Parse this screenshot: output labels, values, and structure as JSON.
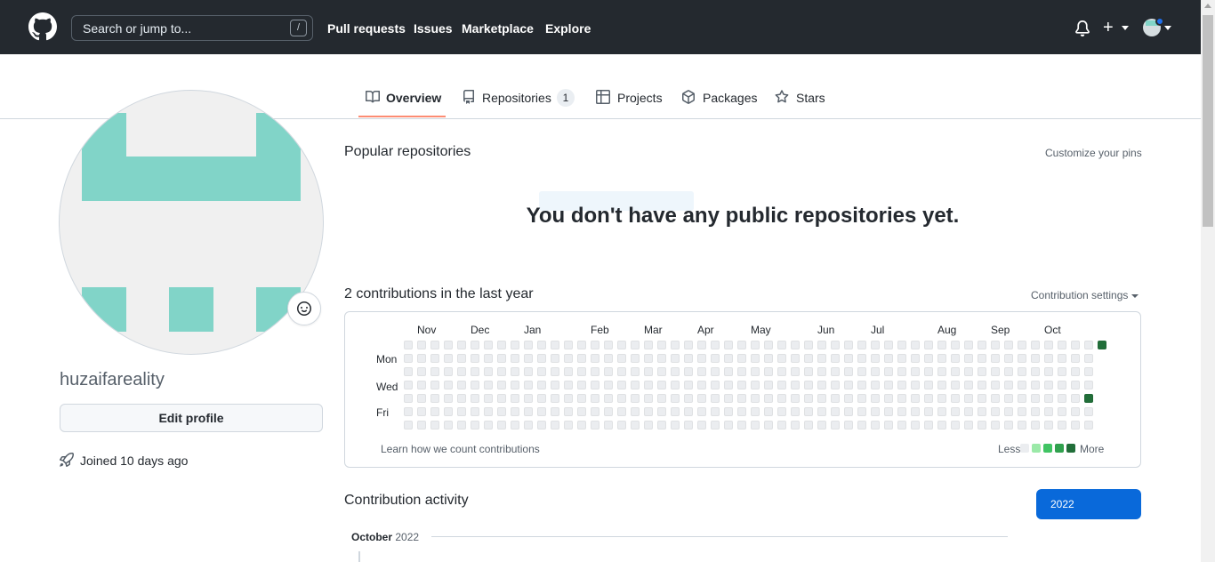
{
  "header": {
    "search_placeholder": "Search or jump to...",
    "search_shortcut": "/",
    "nav": [
      "Pull requests",
      "Issues",
      "Marketplace",
      "Explore"
    ]
  },
  "tabs": {
    "overview": "Overview",
    "repositories": "Repositories",
    "repositories_count": "1",
    "projects": "Projects",
    "packages": "Packages",
    "stars": "Stars"
  },
  "profile": {
    "username": "huzaifareality",
    "edit_label": "Edit profile",
    "joined": "Joined 10 days ago",
    "identicon_color": "#81d4c8"
  },
  "popular": {
    "title": "Popular repositories",
    "customize": "Customize your pins",
    "empty_message": "You don't have any public repositories yet."
  },
  "contributions": {
    "title": "2 contributions in the last year",
    "settings": "Contribution settings",
    "months": [
      "Nov",
      "Dec",
      "Jan",
      "Feb",
      "Mar",
      "Apr",
      "May",
      "Jun",
      "Jul",
      "Aug",
      "Sep",
      "Oct"
    ],
    "days": [
      "Mon",
      "Wed",
      "Fri"
    ],
    "learn_link": "Learn how we count contributions",
    "less": "Less",
    "more": "More",
    "level_colors": [
      "#ebedf0",
      "#9be9a8",
      "#40c463",
      "#30a14e",
      "#216e39"
    ]
  },
  "activity": {
    "title": "Contribution activity",
    "year": "2022",
    "month_label": "October",
    "month_year": "2022"
  }
}
